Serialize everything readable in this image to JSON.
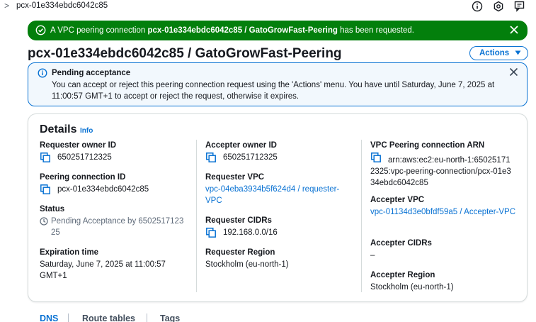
{
  "topbar": {
    "chevron": ">",
    "breadcrumb": "pcx-01e334ebdc6042c85",
    "icons": [
      "info-icon",
      "settings-icon",
      "feedback-icon"
    ]
  },
  "flash": {
    "prefix": "A VPC peering connection ",
    "name": "pcx-01e334ebdc6042c85 / GatoGrowFast-Peering",
    "suffix": " has been requested.",
    "color": "#037f0c"
  },
  "page": {
    "title": "pcx-01e334ebdc6042c85 / GatoGrowFast-Peering",
    "actions_label": "Actions"
  },
  "alert": {
    "title": "Pending acceptance",
    "body": "You can accept or reject this peering connection request using the 'Actions' menu. You have until Saturday, June 7, 2025 at 11:00:57 GMT+1 to accept or reject the request, otherwise it expires."
  },
  "details": {
    "heading": "Details",
    "info_link": "Info",
    "requester_owner_id": {
      "label": "Requester owner ID",
      "value": "650251712325"
    },
    "peering_connection_id": {
      "label": "Peering connection ID",
      "value": "pcx-01e334ebdc6042c85"
    },
    "status": {
      "label": "Status",
      "value": "Pending Acceptance by 6502517123 25"
    },
    "expiration_time": {
      "label": "Expiration time",
      "value": "Saturday, June 7, 2025 at 11:00:57 GMT+1"
    },
    "accepter_owner_id": {
      "label": "Accepter owner ID",
      "value": "650251712325"
    },
    "requester_vpc": {
      "label": "Requester VPC",
      "value": "vpc-04eba3934b5f624d4 / requester-VPC"
    },
    "requester_cidrs": {
      "label": "Requester CIDRs",
      "value": "192.168.0.0/16"
    },
    "requester_region": {
      "label": "Requester Region",
      "value": "Stockholm (eu-north-1)"
    },
    "vpc_peering_arn": {
      "label": "VPC Peering connection ARN",
      "value": "arn:aws:ec2:eu-north-1:650251712325:vpc-peering-connection/pcx-01e334ebdc6042c85"
    },
    "accepter_vpc": {
      "label": "Accepter VPC",
      "value": "vpc-01134d3e0bfdf59a5 / Accepter-VPC"
    },
    "accepter_cidrs": {
      "label": "Accepter CIDRs",
      "value": "–"
    },
    "accepter_region": {
      "label": "Accepter Region",
      "value": "Stockholm (eu-north-1)"
    }
  },
  "tabs": [
    "DNS",
    "Route tables",
    "Tags"
  ],
  "colors": {
    "link": "#0972d3",
    "success": "#037f0c",
    "border": "#d5dbdb"
  }
}
